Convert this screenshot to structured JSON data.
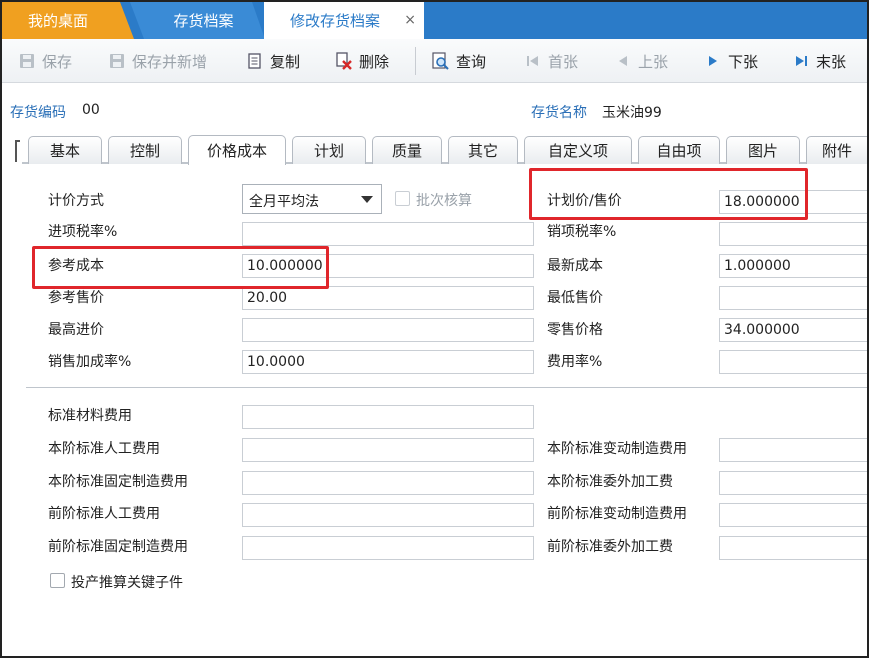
{
  "tabs": {
    "home": "我的桌面",
    "archive": "存货档案",
    "edit": "修改存货档案",
    "close": "×"
  },
  "toolbar": {
    "save": "保存",
    "save_new": "保存并新增",
    "copy": "复制",
    "delete": "删除",
    "query": "查询",
    "first": "首张",
    "prev": "上张",
    "next": "下张",
    "last": "末张"
  },
  "header": {
    "code_label": "存货编码",
    "code_value": "00",
    "name_label": "存货名称",
    "name_value": "玉米油99"
  },
  "inner_tabs": [
    "基本",
    "控制",
    "价格成本",
    "计划",
    "质量",
    "其它",
    "自定义项",
    "自由项",
    "图片",
    "附件"
  ],
  "form": {
    "pricing_method_label": "计价方式",
    "pricing_method_value": "全月平均法",
    "batch_accounting_label": "批次核算",
    "planned_price_label": "计划价/售价",
    "planned_price_value": "18.000000",
    "input_tax_label": "进项税率%",
    "input_tax_value": "",
    "output_tax_label": "销项税率%",
    "output_tax_value": "",
    "ref_cost_label": "参考成本",
    "ref_cost_value": "10.000000",
    "latest_cost_label": "最新成本",
    "latest_cost_value": "1.000000",
    "ref_price_label": "参考售价",
    "ref_price_value": "20.00",
    "min_price_label": "最低售价",
    "min_price_value": "",
    "max_purchase_label": "最高进价",
    "max_purchase_value": "",
    "retail_price_label": "零售价格",
    "retail_price_value": "34.000000",
    "markup_label": "销售加成率%",
    "markup_value": "10.0000",
    "expense_rate_label": "费用率%",
    "expense_rate_value": "",
    "std_material_label": "标准材料费用",
    "cur_std_labor_label": "本阶标准人工费用",
    "cur_std_var_mfg_label": "本阶标准变动制造费用",
    "cur_std_fixed_mfg_label": "本阶标准固定制造费用",
    "cur_std_outsource_label": "本阶标准委外加工费",
    "prev_std_labor_label": "前阶标准人工费用",
    "prev_std_var_mfg_label": "前阶标准变动制造费用",
    "prev_std_fixed_mfg_label": "前阶标准固定制造费用",
    "prev_std_outsource_label": "前阶标准委外加工费",
    "key_subpart_label": "投产推算关键子件"
  }
}
